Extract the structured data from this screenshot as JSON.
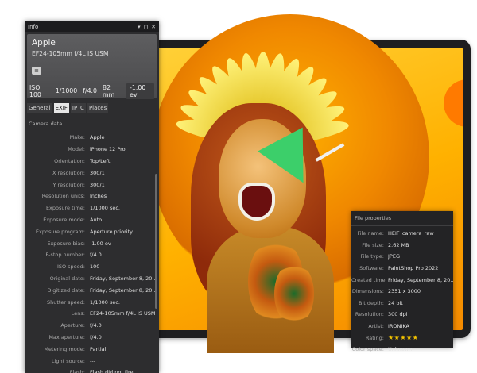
{
  "info_panel": {
    "title": "Info",
    "controls": [
      "▾",
      "⊓",
      "✕"
    ],
    "header": {
      "make": "Apple",
      "lens": "EF24-105mm f/4L IS USM",
      "toggle_glyph": "≡",
      "stats": {
        "iso": "ISO 100",
        "shutter": "1/1000",
        "aperture": "f/4.0",
        "focal": "82 mm",
        "ev": "-1.00 ev"
      }
    },
    "tabs": [
      "General",
      "EXIF",
      "IPTC",
      "Places"
    ],
    "active_tab": "EXIF",
    "section_title": "Camera data",
    "rows": [
      {
        "key": "Make:",
        "value": "Apple"
      },
      {
        "key": "Model:",
        "value": "iPhone 12 Pro"
      },
      {
        "key": "Orientation:",
        "value": "Top/Left"
      },
      {
        "key": "X resolution:",
        "value": "300/1"
      },
      {
        "key": "Y resolution:",
        "value": "300/1"
      },
      {
        "key": "Resolution units:",
        "value": "Inches"
      },
      {
        "key": "Exposure time:",
        "value": "1/1000 sec."
      },
      {
        "key": "Exposure mode:",
        "value": "Auto"
      },
      {
        "key": "Exposure program:",
        "value": "Aperture priority"
      },
      {
        "key": "Exposure bias:",
        "value": "-1.00 ev"
      },
      {
        "key": "F-stop number:",
        "value": "f/4.0"
      },
      {
        "key": "ISO speed:",
        "value": "100"
      },
      {
        "key": "Original date:",
        "value": "Friday, September 8, 20..."
      },
      {
        "key": "Digitized date:",
        "value": "Friday, September 8, 20..."
      },
      {
        "key": "Shutter speed:",
        "value": "1/1000 sec."
      },
      {
        "key": "Lens:",
        "value": "EF24-105mm f/4L IS USM"
      },
      {
        "key": "Aperture:",
        "value": "f/4.0"
      },
      {
        "key": "Max aperture:",
        "value": "f/4.0"
      },
      {
        "key": "Metering mode:",
        "value": "Partial"
      },
      {
        "key": "Light source:",
        "value": "---"
      },
      {
        "key": "Flash:",
        "value": "Flash did not fire"
      }
    ]
  },
  "file_properties": {
    "title": "File properties",
    "rows": [
      {
        "key": "File name:",
        "value": "HEIF_camera_raw"
      },
      {
        "key": "File size:",
        "value": "2.62 MB"
      },
      {
        "key": "File type:",
        "value": "JPEG"
      },
      {
        "key": "Software:",
        "value": "PaintShop Pro 2022"
      },
      {
        "key": "Created time:",
        "value": "Friday, September 8, 20..."
      },
      {
        "key": "Dimensions:",
        "value": "2351 x 3000"
      },
      {
        "key": "Bit depth:",
        "value": "24 bit"
      },
      {
        "key": "Resolution:",
        "value": "300 dpi"
      },
      {
        "key": "Artist:",
        "value": "IRONIKA"
      },
      {
        "key": "Rating:",
        "value": "★★★★★"
      },
      {
        "key": "Color space:",
        "value": "Unknown"
      }
    ],
    "rating_stars": 5
  },
  "colors": {
    "panel_bg": "#2d2d2f",
    "titlebar_bg": "#1c1c1e",
    "accent_star": "#f2c200",
    "screen_yellow": "#ffb100",
    "screen_orange": "#f58a00"
  }
}
